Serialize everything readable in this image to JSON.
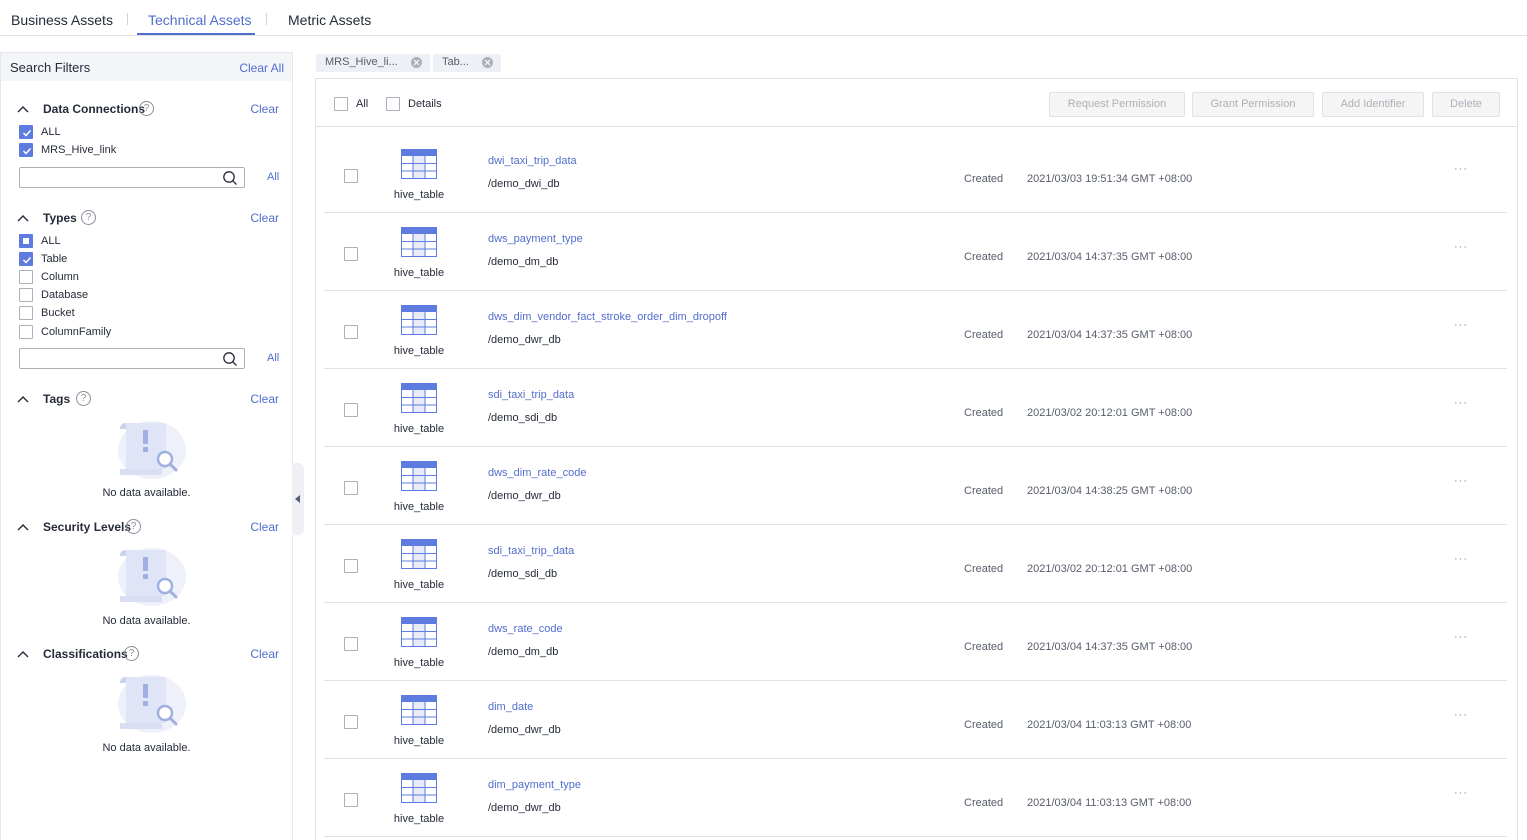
{
  "tabs": [
    {
      "label": "Business Assets"
    },
    {
      "label": "Technical Assets"
    },
    {
      "label": "Metric Assets"
    }
  ],
  "filters": {
    "title": "Search Filters",
    "clear_all": "Clear All",
    "clear": "Clear",
    "all": "All",
    "help": "?",
    "empty": "No data available.",
    "data_connections": {
      "title": "Data Connections",
      "options": [
        {
          "label": "ALL",
          "state": "checked"
        },
        {
          "label": "MRS_Hive_link",
          "state": "checked"
        }
      ],
      "search_value": ""
    },
    "types": {
      "title": "Types",
      "options": [
        {
          "label": "ALL",
          "state": "partial"
        },
        {
          "label": "Table",
          "state": "checked"
        },
        {
          "label": "Column",
          "state": "unchecked"
        },
        {
          "label": "Database",
          "state": "unchecked"
        },
        {
          "label": "Bucket",
          "state": "unchecked"
        },
        {
          "label": "ColumnFamily",
          "state": "unchecked"
        }
      ],
      "search_value": ""
    },
    "tags": {
      "title": "Tags"
    },
    "security_levels": {
      "title": "Security Levels"
    },
    "classifications": {
      "title": "Classifications"
    }
  },
  "chips": [
    {
      "label": "MRS_Hive_li..."
    },
    {
      "label": "Tab..."
    }
  ],
  "toolbar": {
    "all_label": "All",
    "details_label": "Details",
    "request_permission": "Request Permission",
    "grant_permission": "Grant Permission",
    "add_identifier": "Add Identifier",
    "delete": "Delete"
  },
  "results": [
    {
      "type": "hive_table",
      "name": "dwi_taxi_trip_data",
      "path": "/demo_dwi_db",
      "status": "Created",
      "time": "2021/03/03 19:51:34 GMT +08:00",
      "more": "···"
    },
    {
      "type": "hive_table",
      "name": "dws_payment_type",
      "path": "/demo_dm_db",
      "status": "Created",
      "time": "2021/03/04 14:37:35 GMT +08:00",
      "more": "···"
    },
    {
      "type": "hive_table",
      "name": "dws_dim_vendor_fact_stroke_order_dim_dropoff",
      "path": "/demo_dwr_db",
      "status": "Created",
      "time": "2021/03/04 14:37:35 GMT +08:00",
      "more": "···"
    },
    {
      "type": "hive_table",
      "name": "sdi_taxi_trip_data",
      "path": "/demo_sdi_db",
      "status": "Created",
      "time": "2021/03/02 20:12:01 GMT +08:00",
      "more": "···"
    },
    {
      "type": "hive_table",
      "name": "dws_dim_rate_code",
      "path": "/demo_dwr_db",
      "status": "Created",
      "time": "2021/03/04 14:38:25 GMT +08:00",
      "more": "···"
    },
    {
      "type": "hive_table",
      "name": "sdi_taxi_trip_data",
      "path": "/demo_sdi_db",
      "status": "Created",
      "time": "2021/03/02 20:12:01 GMT +08:00",
      "more": "···"
    },
    {
      "type": "hive_table",
      "name": "dws_rate_code",
      "path": "/demo_dm_db",
      "status": "Created",
      "time": "2021/03/04 14:37:35 GMT +08:00",
      "more": "···"
    },
    {
      "type": "hive_table",
      "name": "dim_date",
      "path": "/demo_dwr_db",
      "status": "Created",
      "time": "2021/03/04 11:03:13 GMT +08:00",
      "more": "···"
    },
    {
      "type": "hive_table",
      "name": "dim_payment_type",
      "path": "/demo_dwr_db",
      "status": "Created",
      "time": "2021/03/04 11:03:13 GMT +08:00",
      "more": "···"
    }
  ],
  "colors": {
    "accent": "#526ecc",
    "checkbox": "#5e7ce0",
    "table_icon_header": "#5e7ce0"
  }
}
